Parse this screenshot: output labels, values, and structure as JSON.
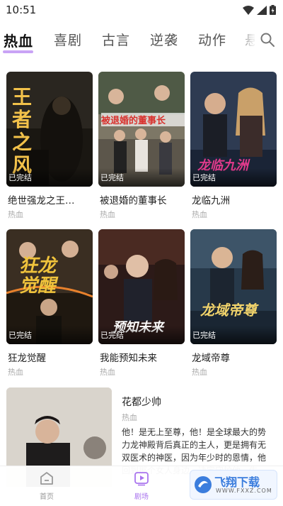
{
  "status_bar": {
    "time": "10:51"
  },
  "tabs": [
    {
      "label": "热血",
      "active": true
    },
    {
      "label": "喜剧"
    },
    {
      "label": "古言"
    },
    {
      "label": "逆袭"
    },
    {
      "label": "动作"
    },
    {
      "label": "悬"
    }
  ],
  "dramas": [
    {
      "title": "绝世强龙之王…",
      "genre": "热血",
      "status": "已完结",
      "poster_text": "王者之风"
    },
    {
      "title": "被退婚的董事长",
      "genre": "热血",
      "status": "已完结",
      "poster_text": "被退婚的董事长"
    },
    {
      "title": "龙临九洲",
      "genre": "热血",
      "status": "已完结",
      "poster_text": "龙临九洲"
    },
    {
      "title": "狂龙觉醒",
      "genre": "热血",
      "status": "已完结",
      "poster_text": "狂龙觉醒"
    },
    {
      "title": "我能预知未来",
      "genre": "热血",
      "status": "已完结",
      "poster_text": "预知未来"
    },
    {
      "title": "龙域帝尊",
      "genre": "热血",
      "status": "已完结",
      "poster_text": "龙域帝尊"
    }
  ],
  "featured": {
    "title": "花都少帅",
    "genre": "热血",
    "description": "他！是无上至尊，他！是全球最大的势力龙神殿背后真正的主人，更是拥有无双医术的神医，因为年少时的恩情，他回到那个女人身边，决定守护他一生。"
  },
  "bottom_nav": [
    {
      "label": "首页",
      "icon": "home-icon",
      "active": false
    },
    {
      "label": "剧场",
      "icon": "play-icon",
      "active": true
    }
  ],
  "watermark": {
    "text": "飞翔下载",
    "sub": "WWW.FXXZ.COM"
  },
  "colors": {
    "accent": "#c9a3f5",
    "active_nav": "#a974ee",
    "inactive_nav": "#999999"
  }
}
